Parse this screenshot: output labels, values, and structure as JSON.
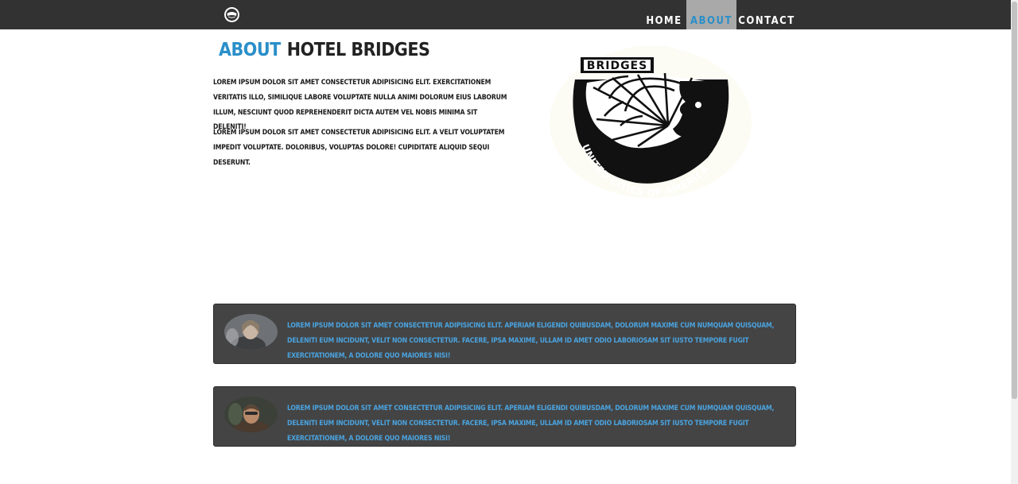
{
  "nav": {
    "logo_icon": "bridges-emblem-icon",
    "items": [
      {
        "label": "HOME",
        "active": false
      },
      {
        "label": "ABOUT",
        "active": true
      },
      {
        "label": "CONTACT",
        "active": false
      }
    ]
  },
  "about": {
    "heading_accent": "ABOUT",
    "heading_rest": "HOTEL BRIDGES",
    "paragraphs": [
      "Lorem ipsum dolor sit amet consectetur adipisicing elit. Exercitationem veritatis illo, similique labore voluptate nulla animi dolorum eius laborum illum, nesciunt quod reprehenderit dicta autem vel nobis minima sit deleniti!",
      "Lorem ipsum dolor sit amet consectetur adipisicing elit. A velit voluptatem impedit voluptate. Doloribus, voluptas dolore! Cupiditate aliquid sequi deserunt."
    ],
    "logo": {
      "top_text": "BRIDGES",
      "arc_text": "UNITED CITIES OF AMERICA"
    }
  },
  "testimonials": [
    {
      "avatar_icon": "woman-portrait-avatar",
      "text": "Lorem ipsum dolor sit amet consectetur adipisicing elit. Aperiam eligendi quibusdam, dolorum maxime cum numquam quisquam, deleniti eum incidunt, velit non consectetur. Facere, ipsa maxime, ullam id amet odio laboriosam sit iusto tempore fugit exercitationem, a dolore quo maiores nisi!"
    },
    {
      "avatar_icon": "man-portrait-avatar",
      "text": "Lorem ipsum dolor sit amet consectetur adipisicing elit. Aperiam eligendi quibusdam, dolorum maxime cum numquam quisquam, deleniti eum incidunt, velit non consectetur. Facere, ipsa maxime, ullam id amet odio laboriosam sit iusto tempore fugit exercitationem, a dolore quo maiores nisi!"
    }
  ],
  "colors": {
    "topbar": "#323232",
    "accent": "#2a8fc9",
    "nav_active_bg": "#a9a9a9",
    "card_bg": "#444444",
    "card_text": "#4aa3df"
  }
}
